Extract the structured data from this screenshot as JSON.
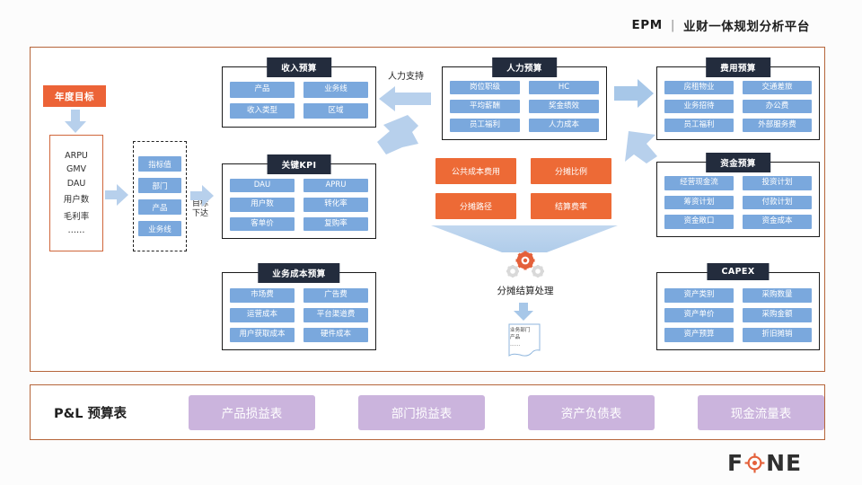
{
  "header": {
    "brand": "EPM",
    "divider": "|",
    "title": "业财一体规划分析平台"
  },
  "annual_target": {
    "label": "年度目标"
  },
  "metrics_box": {
    "items": [
      "ARPU",
      "GMV",
      "DAU",
      "用户数",
      "毛利率",
      "……"
    ]
  },
  "goal_flow_label": {
    "line1": "目标",
    "line2": "下达"
  },
  "dimension_box": {
    "items": [
      "指标值",
      "部门",
      "产品",
      "业务线"
    ]
  },
  "panels": [
    {
      "id": "revenue-budget",
      "title": "收入预算",
      "cells": [
        "产品",
        "业务线",
        "收入类型",
        "区域"
      ]
    },
    {
      "id": "key-kpi",
      "title": "关键KPI",
      "cells": [
        "DAU",
        "APRU",
        "用户数",
        "转化率",
        "客单价",
        "复购率"
      ]
    },
    {
      "id": "business-cost-budget",
      "title": "业务成本预算",
      "cells": [
        "市场费",
        "广告费",
        "运营成本",
        "平台渠道费",
        "用户获取成本",
        "硬件成本"
      ]
    },
    {
      "id": "hr-budget",
      "title": "人力预算",
      "cells": [
        "岗位职级",
        "HC",
        "平均薪酬",
        "奖金绩效",
        "员工福利",
        "人力成本"
      ]
    },
    {
      "id": "expense-budget",
      "title": "费用预算",
      "cells": [
        "房租物业",
        "交通差旅",
        "业务招待",
        "办公费",
        "员工福利",
        "外部服务费"
      ]
    },
    {
      "id": "fund-budget",
      "title": "资金预算",
      "cells": [
        "经营现金流",
        "投资计划",
        "筹资计划",
        "付款计划",
        "资金敞口",
        "资金成本"
      ]
    },
    {
      "id": "capex",
      "title": "CAPEX",
      "cells": [
        "资产类别",
        "采购数量",
        "资产单价",
        "采购金额",
        "资产预算",
        "折旧摊销"
      ]
    }
  ],
  "allocation": {
    "cells": [
      "公共成本费用",
      "分摊比例",
      "分摊路径",
      "结算费率"
    ],
    "process_label": "分摊结算处理",
    "doc_line1": "业务部门",
    "doc_line2": "产品",
    "doc_line3": "……"
  },
  "hr_support_label": "人力支持",
  "pl_section": {
    "title": "P&L 预算表",
    "buttons": [
      "产品损益表",
      "部门损益表",
      "资产负债表",
      "现金流量表"
    ]
  },
  "logo": {
    "left": "F",
    "right": "NE"
  },
  "colors": {
    "frame_border": "#b5653a",
    "accent_orange": "#ed6a36",
    "chip_blue": "#7aa8dd",
    "panel_title_dark": "#232c3d",
    "pl_purple": "#cbb4dd"
  }
}
